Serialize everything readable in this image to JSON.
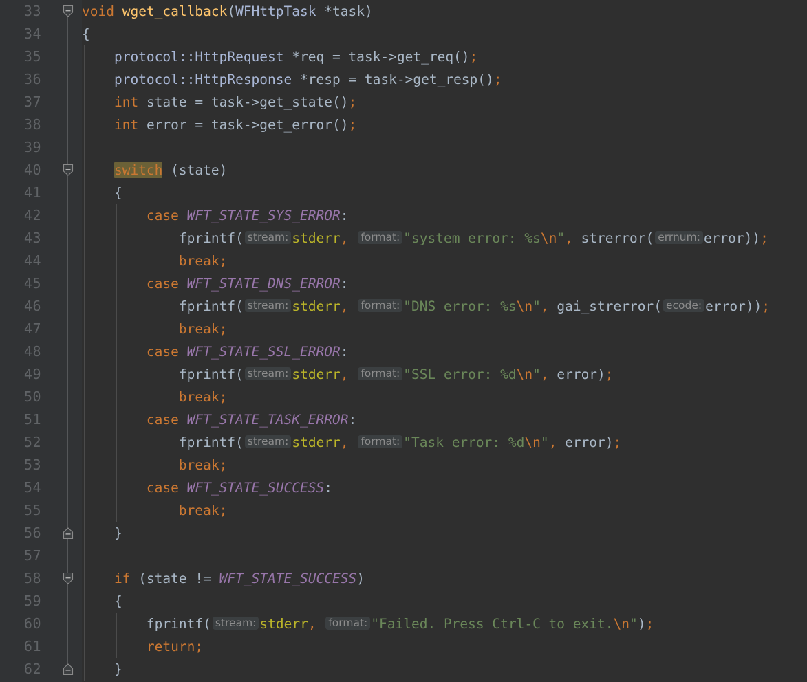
{
  "editor": {
    "app": "code-editor",
    "language": "C++",
    "theme_name": "Darcula",
    "colors": {
      "background": "#2f2f2f",
      "gutter_background": "#313335",
      "line_number": "#606366",
      "default_text": "#a9b7c6",
      "keyword": "#cc7832",
      "string": "#6a8759",
      "escape": "#cc7832",
      "constant": "#9876aa",
      "function_decl": "#ffc66d",
      "static_field": "#bbb529",
      "class_type": "#a9b7d6",
      "param_hint_bg": "#3b3f41",
      "param_hint_fg": "#8c8c8c",
      "identifier_highlight_bg": "#6b6137",
      "indent_guide": "#4b4b4b",
      "fold_rail": "#555759"
    },
    "first_line_number": 33,
    "last_line_number": 62,
    "line_height_px": 33
  },
  "lines": [
    {
      "number": "33",
      "fold": "start",
      "indent_guides": [],
      "tokens": [
        {
          "t": "void",
          "c": "kw"
        },
        {
          "t": " ",
          "c": "ident"
        },
        {
          "t": "wget_callback",
          "c": "fnname"
        },
        {
          "t": "(",
          "c": "punc"
        },
        {
          "t": "WFHttpTask",
          "c": "type"
        },
        {
          "t": " *task)",
          "c": "ident"
        }
      ]
    },
    {
      "number": "34",
      "fold": "",
      "indent_guides": [],
      "tokens": [
        {
          "t": "{",
          "c": "ident"
        }
      ]
    },
    {
      "number": "35",
      "fold": "",
      "indent_guides": [
        0
      ],
      "tokens": [
        {
          "t": "    ",
          "c": "ident"
        },
        {
          "t": "protocol",
          "c": "type"
        },
        {
          "t": "::",
          "c": "type"
        },
        {
          "t": "HttpRequest",
          "c": "type"
        },
        {
          "t": " *req = task->get_req()",
          "c": "ident"
        },
        {
          "t": ";",
          "c": "semi"
        }
      ]
    },
    {
      "number": "36",
      "fold": "",
      "indent_guides": [
        0
      ],
      "tokens": [
        {
          "t": "    ",
          "c": "ident"
        },
        {
          "t": "protocol",
          "c": "type"
        },
        {
          "t": "::",
          "c": "type"
        },
        {
          "t": "HttpResponse",
          "c": "type"
        },
        {
          "t": " *resp = task->get_resp()",
          "c": "ident"
        },
        {
          "t": ";",
          "c": "semi"
        }
      ]
    },
    {
      "number": "37",
      "fold": "",
      "indent_guides": [
        0
      ],
      "tokens": [
        {
          "t": "    ",
          "c": "ident"
        },
        {
          "t": "int",
          "c": "kw"
        },
        {
          "t": " state = task->get_state()",
          "c": "ident"
        },
        {
          "t": ";",
          "c": "semi"
        }
      ]
    },
    {
      "number": "38",
      "fold": "",
      "indent_guides": [
        0
      ],
      "tokens": [
        {
          "t": "    ",
          "c": "ident"
        },
        {
          "t": "int",
          "c": "kw"
        },
        {
          "t": " error = task->get_error()",
          "c": "ident"
        },
        {
          "t": ";",
          "c": "semi"
        }
      ]
    },
    {
      "number": "39",
      "fold": "",
      "indent_guides": [
        0
      ],
      "tokens": []
    },
    {
      "number": "40",
      "fold": "start",
      "indent_guides": [
        0
      ],
      "tokens": [
        {
          "t": "    ",
          "c": "ident"
        },
        {
          "t": "switch",
          "c": "hl-switch"
        },
        {
          "t": " (state)",
          "c": "ident"
        }
      ]
    },
    {
      "number": "41",
      "fold": "",
      "indent_guides": [
        0
      ],
      "tokens": [
        {
          "t": "    {",
          "c": "ident"
        }
      ]
    },
    {
      "number": "42",
      "fold": "",
      "indent_guides": [
        0,
        1
      ],
      "tokens": [
        {
          "t": "        ",
          "c": "ident"
        },
        {
          "t": "case",
          "c": "kw"
        },
        {
          "t": " ",
          "c": "ident"
        },
        {
          "t": "WFT_STATE_SYS_ERROR",
          "c": "const"
        },
        {
          "t": ":",
          "c": "ident"
        }
      ]
    },
    {
      "number": "43",
      "fold": "",
      "indent_guides": [
        0,
        1,
        2
      ],
      "tokens": [
        {
          "t": "            fprintf(",
          "c": "ident"
        },
        {
          "t": "stream:",
          "c": "phint"
        },
        {
          "t": "stderr",
          "c": "field"
        },
        {
          "t": ",",
          "c": "semi"
        },
        {
          "t": " ",
          "c": "ident"
        },
        {
          "t": "format:",
          "c": "phint"
        },
        {
          "t": "\"system error: %s",
          "c": "str"
        },
        {
          "t": "\\n",
          "c": "esc"
        },
        {
          "t": "\"",
          "c": "str"
        },
        {
          "t": ",",
          "c": "semi"
        },
        {
          "t": " strerror(",
          "c": "ident"
        },
        {
          "t": "errnum:",
          "c": "phint"
        },
        {
          "t": "error))",
          "c": "ident"
        },
        {
          "t": ";",
          "c": "semi"
        }
      ]
    },
    {
      "number": "44",
      "fold": "",
      "indent_guides": [
        0,
        1,
        2
      ],
      "tokens": [
        {
          "t": "            ",
          "c": "ident"
        },
        {
          "t": "break",
          "c": "kw"
        },
        {
          "t": ";",
          "c": "semi"
        }
      ]
    },
    {
      "number": "45",
      "fold": "",
      "indent_guides": [
        0,
        1
      ],
      "tokens": [
        {
          "t": "        ",
          "c": "ident"
        },
        {
          "t": "case",
          "c": "kw"
        },
        {
          "t": " ",
          "c": "ident"
        },
        {
          "t": "WFT_STATE_DNS_ERROR",
          "c": "const"
        },
        {
          "t": ":",
          "c": "ident"
        }
      ]
    },
    {
      "number": "46",
      "fold": "",
      "indent_guides": [
        0,
        1,
        2
      ],
      "tokens": [
        {
          "t": "            fprintf(",
          "c": "ident"
        },
        {
          "t": "stream:",
          "c": "phint"
        },
        {
          "t": "stderr",
          "c": "field"
        },
        {
          "t": ",",
          "c": "semi"
        },
        {
          "t": " ",
          "c": "ident"
        },
        {
          "t": "format:",
          "c": "phint"
        },
        {
          "t": "\"DNS error: %s",
          "c": "str"
        },
        {
          "t": "\\n",
          "c": "esc"
        },
        {
          "t": "\"",
          "c": "str"
        },
        {
          "t": ",",
          "c": "semi"
        },
        {
          "t": " gai_strerror(",
          "c": "ident"
        },
        {
          "t": "ecode:",
          "c": "phint"
        },
        {
          "t": "error))",
          "c": "ident"
        },
        {
          "t": ";",
          "c": "semi"
        }
      ]
    },
    {
      "number": "47",
      "fold": "",
      "indent_guides": [
        0,
        1,
        2
      ],
      "tokens": [
        {
          "t": "            ",
          "c": "ident"
        },
        {
          "t": "break",
          "c": "kw"
        },
        {
          "t": ";",
          "c": "semi"
        }
      ]
    },
    {
      "number": "48",
      "fold": "",
      "indent_guides": [
        0,
        1
      ],
      "tokens": [
        {
          "t": "        ",
          "c": "ident"
        },
        {
          "t": "case",
          "c": "kw"
        },
        {
          "t": " ",
          "c": "ident"
        },
        {
          "t": "WFT_STATE_SSL_ERROR",
          "c": "const"
        },
        {
          "t": ":",
          "c": "ident"
        }
      ]
    },
    {
      "number": "49",
      "fold": "",
      "indent_guides": [
        0,
        1,
        2
      ],
      "tokens": [
        {
          "t": "            fprintf(",
          "c": "ident"
        },
        {
          "t": "stream:",
          "c": "phint"
        },
        {
          "t": "stderr",
          "c": "field"
        },
        {
          "t": ",",
          "c": "semi"
        },
        {
          "t": " ",
          "c": "ident"
        },
        {
          "t": "format:",
          "c": "phint"
        },
        {
          "t": "\"SSL error: %d",
          "c": "str"
        },
        {
          "t": "\\n",
          "c": "esc"
        },
        {
          "t": "\"",
          "c": "str"
        },
        {
          "t": ",",
          "c": "semi"
        },
        {
          "t": " error)",
          "c": "ident"
        },
        {
          "t": ";",
          "c": "semi"
        }
      ]
    },
    {
      "number": "50",
      "fold": "",
      "indent_guides": [
        0,
        1,
        2
      ],
      "tokens": [
        {
          "t": "            ",
          "c": "ident"
        },
        {
          "t": "break",
          "c": "kw"
        },
        {
          "t": ";",
          "c": "semi"
        }
      ]
    },
    {
      "number": "51",
      "fold": "",
      "indent_guides": [
        0,
        1
      ],
      "tokens": [
        {
          "t": "        ",
          "c": "ident"
        },
        {
          "t": "case",
          "c": "kw"
        },
        {
          "t": " ",
          "c": "ident"
        },
        {
          "t": "WFT_STATE_TASK_ERROR",
          "c": "const"
        },
        {
          "t": ":",
          "c": "ident"
        }
      ]
    },
    {
      "number": "52",
      "fold": "",
      "indent_guides": [
        0,
        1,
        2
      ],
      "tokens": [
        {
          "t": "            fprintf(",
          "c": "ident"
        },
        {
          "t": "stream:",
          "c": "phint"
        },
        {
          "t": "stderr",
          "c": "field"
        },
        {
          "t": ",",
          "c": "semi"
        },
        {
          "t": " ",
          "c": "ident"
        },
        {
          "t": "format:",
          "c": "phint"
        },
        {
          "t": "\"Task error: %d",
          "c": "str"
        },
        {
          "t": "\\n",
          "c": "esc"
        },
        {
          "t": "\"",
          "c": "str"
        },
        {
          "t": ",",
          "c": "semi"
        },
        {
          "t": " error)",
          "c": "ident"
        },
        {
          "t": ";",
          "c": "semi"
        }
      ]
    },
    {
      "number": "53",
      "fold": "",
      "indent_guides": [
        0,
        1,
        2
      ],
      "tokens": [
        {
          "t": "            ",
          "c": "ident"
        },
        {
          "t": "break",
          "c": "kw"
        },
        {
          "t": ";",
          "c": "semi"
        }
      ]
    },
    {
      "number": "54",
      "fold": "",
      "indent_guides": [
        0,
        1
      ],
      "tokens": [
        {
          "t": "        ",
          "c": "ident"
        },
        {
          "t": "case",
          "c": "kw"
        },
        {
          "t": " ",
          "c": "ident"
        },
        {
          "t": "WFT_STATE_SUCCESS",
          "c": "const"
        },
        {
          "t": ":",
          "c": "ident"
        }
      ]
    },
    {
      "number": "55",
      "fold": "",
      "indent_guides": [
        0,
        1,
        2
      ],
      "tokens": [
        {
          "t": "            ",
          "c": "ident"
        },
        {
          "t": "break",
          "c": "kw"
        },
        {
          "t": ";",
          "c": "semi"
        }
      ]
    },
    {
      "number": "56",
      "fold": "end",
      "indent_guides": [
        0
      ],
      "tokens": [
        {
          "t": "    }",
          "c": "ident"
        }
      ]
    },
    {
      "number": "57",
      "fold": "",
      "indent_guides": [
        0
      ],
      "tokens": []
    },
    {
      "number": "58",
      "fold": "start",
      "indent_guides": [
        0
      ],
      "tokens": [
        {
          "t": "    ",
          "c": "ident"
        },
        {
          "t": "if",
          "c": "kw"
        },
        {
          "t": " (state != ",
          "c": "ident"
        },
        {
          "t": "WFT_STATE_SUCCESS",
          "c": "const"
        },
        {
          "t": ")",
          "c": "ident"
        }
      ]
    },
    {
      "number": "59",
      "fold": "",
      "indent_guides": [
        0
      ],
      "tokens": [
        {
          "t": "    {",
          "c": "ident"
        }
      ]
    },
    {
      "number": "60",
      "fold": "",
      "indent_guides": [
        0,
        1
      ],
      "tokens": [
        {
          "t": "        fprintf(",
          "c": "ident"
        },
        {
          "t": "stream:",
          "c": "phint"
        },
        {
          "t": "stderr",
          "c": "field"
        },
        {
          "t": ",",
          "c": "semi"
        },
        {
          "t": " ",
          "c": "ident"
        },
        {
          "t": "format:",
          "c": "phint"
        },
        {
          "t": "\"Failed. Press Ctrl-C to exit.",
          "c": "str"
        },
        {
          "t": "\\n",
          "c": "esc"
        },
        {
          "t": "\"",
          "c": "str"
        },
        {
          "t": ")",
          "c": "ident"
        },
        {
          "t": ";",
          "c": "semi"
        }
      ]
    },
    {
      "number": "61",
      "fold": "",
      "indent_guides": [
        0,
        1
      ],
      "tokens": [
        {
          "t": "        ",
          "c": "ident"
        },
        {
          "t": "return",
          "c": "kw"
        },
        {
          "t": ";",
          "c": "semi"
        }
      ]
    },
    {
      "number": "62",
      "fold": "end",
      "indent_guides": [
        0
      ],
      "tokens": [
        {
          "t": "    }",
          "c": "ident"
        }
      ]
    }
  ]
}
